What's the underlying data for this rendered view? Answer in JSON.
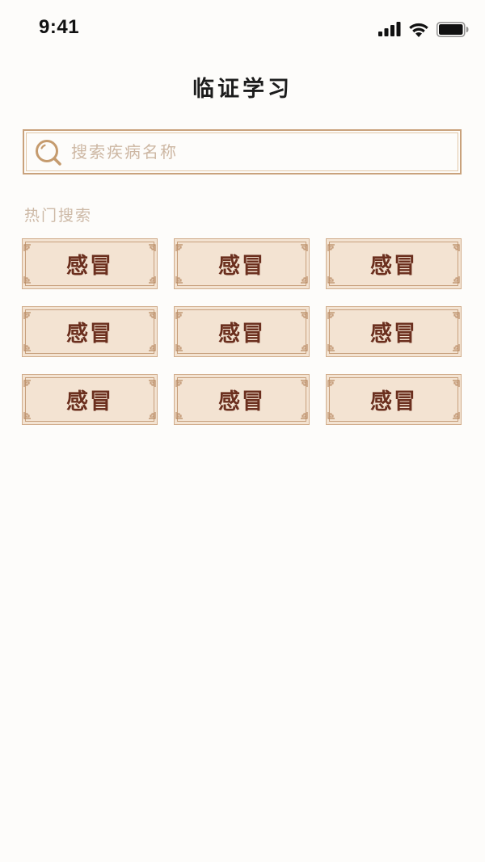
{
  "status_bar": {
    "time": "9:41",
    "icons": [
      "signal-icon",
      "wifi-icon",
      "battery-icon"
    ]
  },
  "header": {
    "title": "临证学习"
  },
  "search": {
    "placeholder": "搜索疾病名称",
    "value": "",
    "icon": "search-icon"
  },
  "hot_search": {
    "label": "热门搜索",
    "items": [
      {
        "label": "感冒"
      },
      {
        "label": "感冒"
      },
      {
        "label": "感冒"
      },
      {
        "label": "感冒"
      },
      {
        "label": "感冒"
      },
      {
        "label": "感冒"
      },
      {
        "label": "感冒"
      },
      {
        "label": "感冒"
      },
      {
        "label": "感冒"
      }
    ]
  },
  "colors": {
    "background": "#fdfcfa",
    "accent_border": "#c9a27c",
    "tag_background": "#f3e3d2",
    "tag_text": "#6b2f1e",
    "muted_text": "#cdb9a6"
  }
}
